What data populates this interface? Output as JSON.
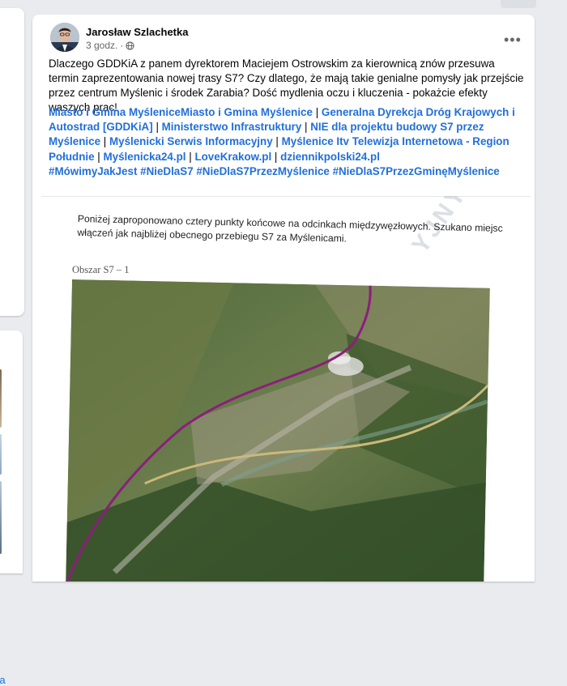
{
  "post": {
    "author": "Jarosław Szlachetka",
    "time": "3 godz.",
    "meta_separator": "·",
    "more_icon": "more-icon",
    "body": "Dlaczego GDDKiA z panem dyrektorem Maciejem Ostrowskim za kierownicą znów przesuwa termin zaprezentowania nowej trasy S7? Czy dlatego, że mają takie genialne pomysły jak przejście przez centrum Myślenic i środek Zarabia? Dość mydlenia oczu i kluczenia - pokażcie efekty waszych prac!",
    "tags": [
      "Miasto i Gmina MyśleniceMiasto i Gmina Myślenice",
      "Generalna Dyrekcja Dróg Krajowych i Autostrad [GDDKiA]",
      "Ministerstwo Infrastruktury",
      "NIE dla projektu budowy S7 przez Myślenice",
      "Myślenicki Serwis Informacyjny",
      "Myślenice Itv Telewizja Internetowa - Region Południe",
      "Myślenicka24.pl",
      "LoveKrakow.pl",
      "dziennikpolski24.pl"
    ],
    "tag_separator": "|",
    "hashtags": "#MówimyJakJest #NieDlaS7 #NieDlaS7PrzezMyślenice #NieDlaS7PrzezGminęMyślenice"
  },
  "attachment": {
    "text": "Poniżej zaproponowano cztery punkty końcowe na odcinkach międzywęzłowych. Szukano miejsc włączeń jak najbliżej obecnego przebiegu S7 za Myślenicami.",
    "watermark": "YJNY",
    "area_label": "Obszar S7 – 1",
    "route_color": "#8a1f7a",
    "road_color": "#cbb97a"
  },
  "sidebar": {
    "partial_label": "cia"
  },
  "colors": {
    "link": "#216fdb",
    "page_bg": "#e9ebee"
  }
}
